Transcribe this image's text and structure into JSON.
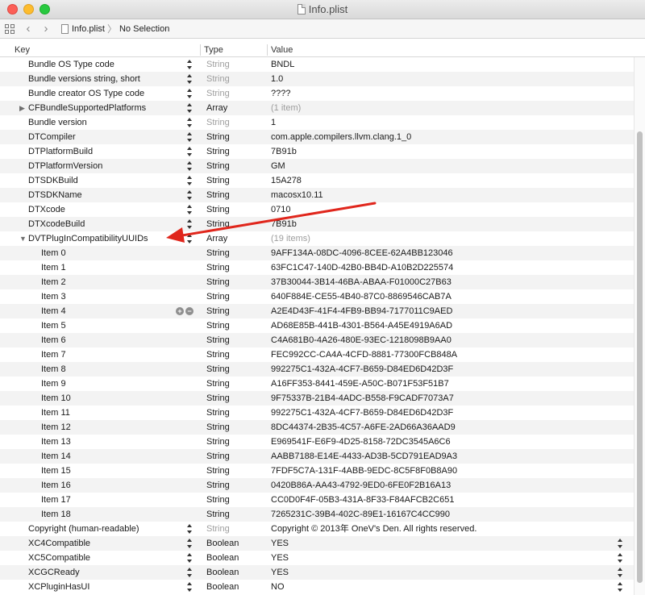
{
  "window": {
    "title": "Info.plist"
  },
  "jumpbar": {
    "crumbs": [
      "Info.plist",
      "No Selection"
    ]
  },
  "columns": {
    "key": "Key",
    "type": "Type",
    "value": "Value"
  },
  "rows": [
    {
      "key": "Bundle OS Type code",
      "type": "String",
      "value": "BNDL",
      "type_gray": true
    },
    {
      "key": "Bundle versions string, short",
      "type": "String",
      "value": "1.0",
      "type_gray": true
    },
    {
      "key": "Bundle creator OS Type code",
      "type": "String",
      "value": "????",
      "type_gray": true
    },
    {
      "key": "CFBundleSupportedPlatforms",
      "type": "Array",
      "value": "(1 item)",
      "disclosure": "collapsed",
      "value_gray": true
    },
    {
      "key": "Bundle version",
      "type": "String",
      "value": "1",
      "type_gray": true
    },
    {
      "key": "DTCompiler",
      "type": "String",
      "value": "com.apple.compilers.llvm.clang.1_0"
    },
    {
      "key": "DTPlatformBuild",
      "type": "String",
      "value": "7B91b"
    },
    {
      "key": "DTPlatformVersion",
      "type": "String",
      "value": "GM"
    },
    {
      "key": "DTSDKBuild",
      "type": "String",
      "value": "15A278"
    },
    {
      "key": "DTSDKName",
      "type": "String",
      "value": "macosx10.11"
    },
    {
      "key": "DTXcode",
      "type": "String",
      "value": "0710"
    },
    {
      "key": "DTXcodeBuild",
      "type": "String",
      "value": "7B91b"
    },
    {
      "key": "DVTPlugInCompatibilityUUIDs",
      "type": "Array",
      "value": "(19 items)",
      "disclosure": "expanded",
      "value_gray": true
    },
    {
      "key": "Item 0",
      "type": "String",
      "value": "9AFF134A-08DC-4096-8CEE-62A4BB123046",
      "child": true
    },
    {
      "key": "Item 1",
      "type": "String",
      "value": "63FC1C47-140D-42B0-BB4D-A10B2D225574",
      "child": true
    },
    {
      "key": "Item 2",
      "type": "String",
      "value": "37B30044-3B14-46BA-ABAA-F01000C27B63",
      "child": true
    },
    {
      "key": "Item 3",
      "type": "String",
      "value": "640F884E-CE55-4B40-87C0-8869546CAB7A",
      "child": true
    },
    {
      "key": "Item 4",
      "type": "String",
      "value": "A2E4D43F-41F4-4FB9-BB94-7177011C9AED",
      "child": true,
      "hover": true
    },
    {
      "key": "Item 5",
      "type": "String",
      "value": "AD68E85B-441B-4301-B564-A45E4919A6AD",
      "child": true
    },
    {
      "key": "Item 6",
      "type": "String",
      "value": "C4A681B0-4A26-480E-93EC-1218098B9AA0",
      "child": true
    },
    {
      "key": "Item 7",
      "type": "String",
      "value": "FEC992CC-CA4A-4CFD-8881-77300FCB848A",
      "child": true
    },
    {
      "key": "Item 8",
      "type": "String",
      "value": "992275C1-432A-4CF7-B659-D84ED6D42D3F",
      "child": true
    },
    {
      "key": "Item 9",
      "type": "String",
      "value": "A16FF353-8441-459E-A50C-B071F53F51B7",
      "child": true
    },
    {
      "key": "Item 10",
      "type": "String",
      "value": "9F75337B-21B4-4ADC-B558-F9CADF7073A7",
      "child": true
    },
    {
      "key": "Item 11",
      "type": "String",
      "value": "992275C1-432A-4CF7-B659-D84ED6D42D3F",
      "child": true
    },
    {
      "key": "Item 12",
      "type": "String",
      "value": "8DC44374-2B35-4C57-A6FE-2AD66A36AAD9",
      "child": true
    },
    {
      "key": "Item 13",
      "type": "String",
      "value": "E969541F-E6F9-4D25-8158-72DC3545A6C6",
      "child": true
    },
    {
      "key": "Item 14",
      "type": "String",
      "value": "AABB7188-E14E-4433-AD3B-5CD791EAD9A3",
      "child": true
    },
    {
      "key": "Item 15",
      "type": "String",
      "value": "7FDF5C7A-131F-4ABB-9EDC-8C5F8F0B8A90",
      "child": true
    },
    {
      "key": "Item 16",
      "type": "String",
      "value": "0420B86A-AA43-4792-9ED0-6FE0F2B16A13",
      "child": true
    },
    {
      "key": "Item 17",
      "type": "String",
      "value": "CC0D0F4F-05B3-431A-8F33-F84AFCB2C651",
      "child": true
    },
    {
      "key": "Item 18",
      "type": "String",
      "value": "7265231C-39B4-402C-89E1-16167C4CC990",
      "child": true
    },
    {
      "key": "Copyright (human-readable)",
      "type": "String",
      "value": "Copyright © 2013年 OneV's Den. All rights reserved.",
      "type_gray": true
    },
    {
      "key": "XC4Compatible",
      "type": "Boolean",
      "value": "YES",
      "value_stepper": true
    },
    {
      "key": "XC5Compatible",
      "type": "Boolean",
      "value": "YES",
      "value_stepper": true
    },
    {
      "key": "XCGCReady",
      "type": "Boolean",
      "value": "YES",
      "value_stepper": true
    },
    {
      "key": "XCPluginHasUI",
      "type": "Boolean",
      "value": "NO",
      "value_stepper": true
    }
  ],
  "colors": {
    "annotation_arrow": "#e0261c",
    "alt_row": "#f3f3f3",
    "gray_text": "#9d9d9d"
  },
  "icons": [
    "close-button",
    "minimize-button",
    "zoom-button",
    "grid-icon",
    "back-arrow-icon",
    "forward-arrow-icon",
    "document-icon",
    "disclosure-triangle-icon",
    "stepper-icon",
    "add-icon",
    "remove-icon"
  ]
}
